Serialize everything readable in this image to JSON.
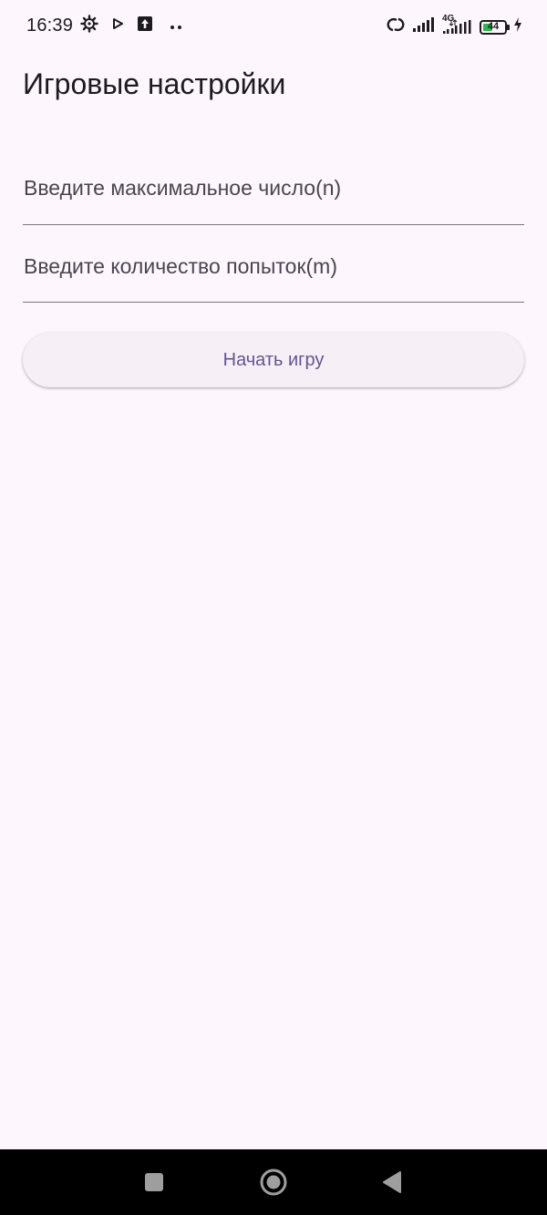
{
  "status_bar": {
    "time": "16:39",
    "network_type": "4G",
    "battery_level": "44",
    "battery_fraction": 0.44,
    "icons": [
      "settings-gear-icon",
      "play-store-icon",
      "upload-icon",
      "more-dots-icon",
      "link-icon",
      "signal-icon",
      "signal-4g-icon",
      "battery-icon",
      "charging-bolt-icon"
    ]
  },
  "app_bar": {
    "title": "Игровые настройки"
  },
  "form": {
    "max_number": {
      "placeholder": "Введите максимальное число(n)",
      "value": ""
    },
    "attempts": {
      "placeholder": "Введите количество попыток(m)",
      "value": ""
    },
    "start_button_label": "Начать игру"
  },
  "nav_bar": {
    "buttons": [
      "recent-apps-icon",
      "home-icon",
      "back-icon"
    ]
  },
  "colors": {
    "background": "#FEF6FD",
    "primary": "#65558F",
    "button_surface": "#F6F0F6",
    "text": "#1D1B20",
    "hint_text": "#49454F",
    "underline": "#79747E",
    "battery_green": "#2DB84D",
    "nav_bar": "#000000"
  }
}
